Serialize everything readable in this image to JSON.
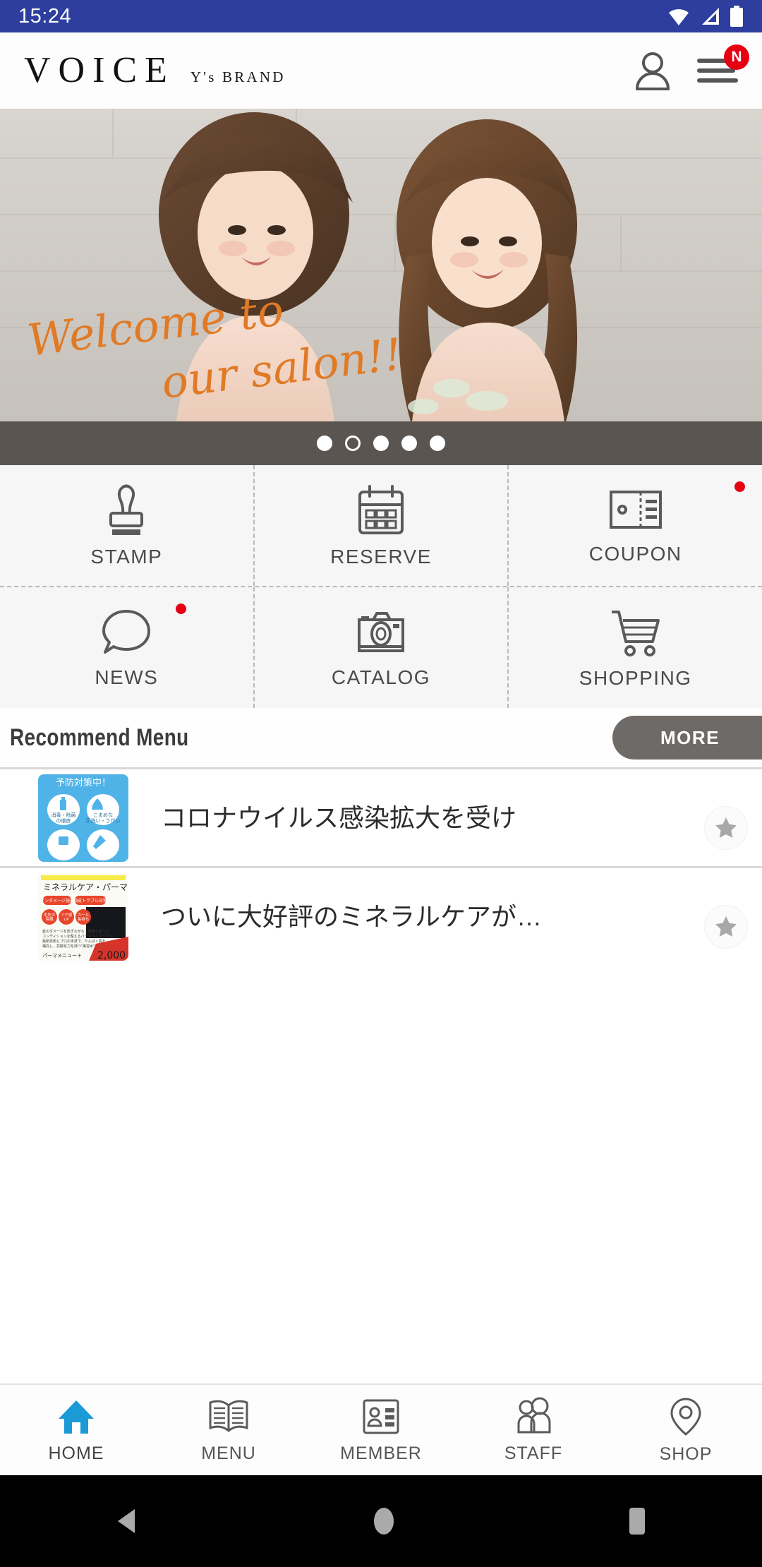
{
  "status_bar": {
    "time": "15:24",
    "icons": [
      "wifi-icon",
      "signal-icon",
      "battery-icon"
    ],
    "background": "#2d3e9e"
  },
  "header": {
    "logo_main": "VOICE",
    "logo_sub": "Y's BRAND",
    "account_icon": "person-icon",
    "menu_icon": "hamburger-menu-icon",
    "menu_badge": "N",
    "badge_color": "#e60012"
  },
  "hero": {
    "script_line1": "Welcome to",
    "script_line2": "our salon!!",
    "script_color": "#e07a25",
    "carousel": {
      "total": 5,
      "active_index": 2,
      "dot_color": "#ffffff",
      "bar_background": "#5b5552"
    }
  },
  "quick_grid": {
    "rows": [
      [
        {
          "label": "STAMP",
          "icon": "stamp-icon",
          "notification": false
        },
        {
          "label": "RESERVE",
          "icon": "calendar-icon",
          "notification": false
        },
        {
          "label": "COUPON",
          "icon": "coupon-ticket-icon",
          "notification": true
        }
      ],
      [
        {
          "label": "NEWS",
          "icon": "speech-bubble-icon",
          "notification": true
        },
        {
          "label": "CATALOG",
          "icon": "camera-icon",
          "notification": false
        },
        {
          "label": "SHOPPING",
          "icon": "shopping-cart-icon",
          "notification": false
        }
      ]
    ]
  },
  "recommend": {
    "title": "Recommend Menu",
    "more_label": "MORE",
    "more_color": "#6e6a68",
    "items": [
      {
        "title": "コロナウイルス感染拡大を受け",
        "thumb": "covid-prevention-poster",
        "thumb_color": "#4fb3e8",
        "star_icon": "star-icon",
        "favorited": false
      },
      {
        "title": "ついに大好評のミネラルケアが…",
        "thumb": "mineral-care-perm-flyer",
        "thumb_color": "#f2f2ea",
        "star_icon": "star-icon",
        "favorited": false
      }
    ]
  },
  "bottom_nav": {
    "active": "HOME",
    "active_color": "#1a9ad6",
    "items": [
      {
        "label": "HOME",
        "icon": "home-icon"
      },
      {
        "label": "MENU",
        "icon": "book-icon"
      },
      {
        "label": "MEMBER",
        "icon": "id-card-icon"
      },
      {
        "label": "STAFF",
        "icon": "people-icon"
      },
      {
        "label": "SHOP",
        "icon": "map-pin-icon"
      }
    ]
  },
  "android_nav": {
    "buttons": [
      {
        "name": "back-button",
        "icon": "triangle-back-icon"
      },
      {
        "name": "home-button",
        "icon": "circle-home-icon"
      },
      {
        "name": "recents-button",
        "icon": "square-recents-icon"
      }
    ]
  }
}
